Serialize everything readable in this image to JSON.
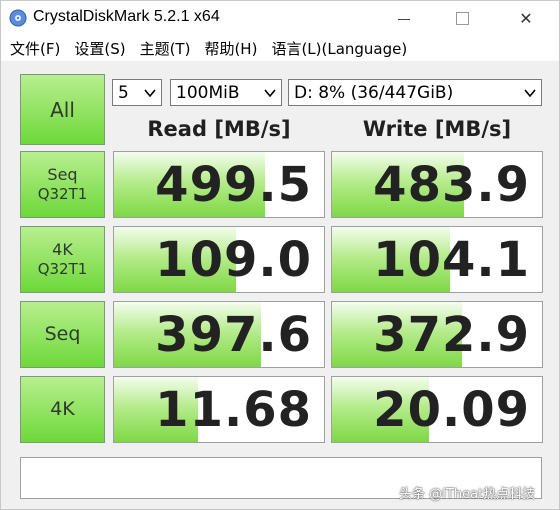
{
  "window": {
    "title": "CrystalDiskMark 5.2.1 x64",
    "minimize": "—",
    "close": "✕"
  },
  "menu": [
    "文件(F)",
    "设置(S)",
    "主题(T)",
    "帮助(H)",
    "语言(L)(Language)"
  ],
  "controls": {
    "all_label": "All",
    "count": "5",
    "size": "100MiB",
    "drive": "D: 8% (36/447GiB)"
  },
  "headers": {
    "read": "Read [MB/s]",
    "write": "Write [MB/s]"
  },
  "rows": [
    {
      "label1": "Seq",
      "label2": "Q32T1",
      "read": "499.5",
      "write": "483.9",
      "read_fill": 0.72,
      "write_fill": 0.63
    },
    {
      "label1": "4K",
      "label2": "Q32T1",
      "read": "109.0",
      "write": "104.1",
      "read_fill": 0.58,
      "write_fill": 0.56
    },
    {
      "label1": "Seq",
      "label2": "",
      "read": "397.6",
      "write": "372.9",
      "read_fill": 0.7,
      "write_fill": 0.62
    },
    {
      "label1": "4K",
      "label2": "",
      "read": "11.68",
      "write": "20.09",
      "read_fill": 0.4,
      "write_fill": 0.46
    }
  ],
  "comment": "",
  "watermark": "头条 @ITheat热点科技",
  "colors": {
    "button_green": "#6ed83a",
    "bar_green": "#7fd846"
  }
}
